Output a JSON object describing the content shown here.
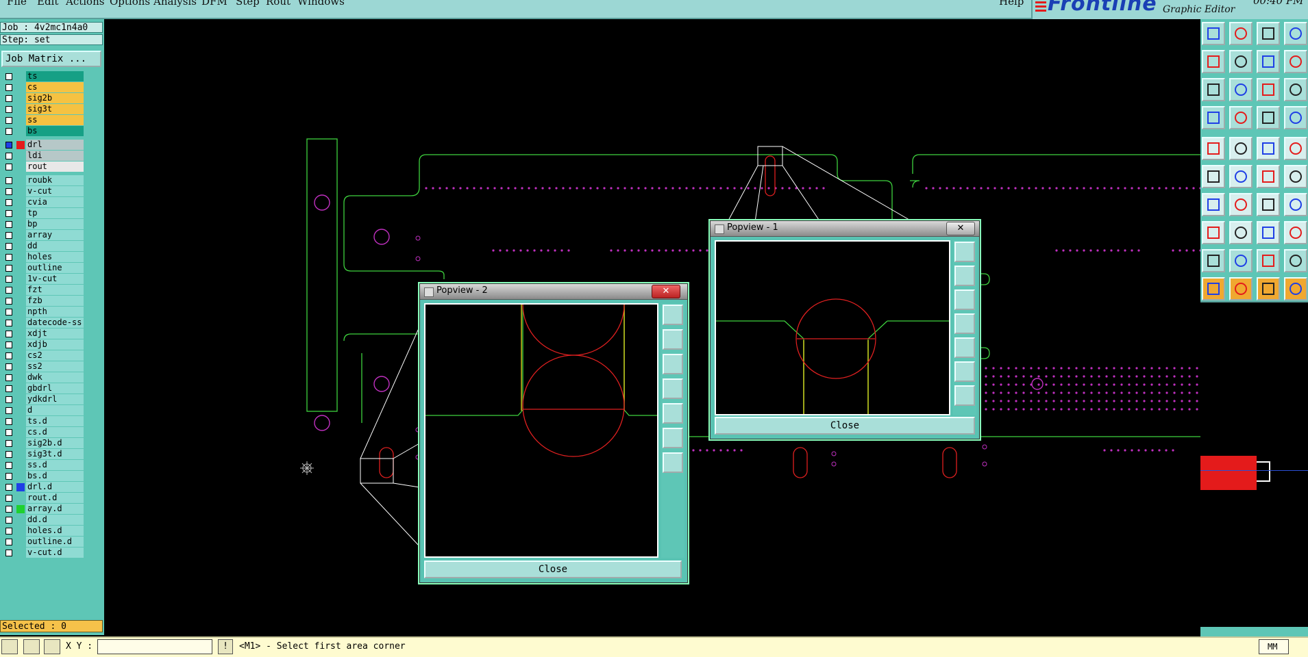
{
  "menu": {
    "items": [
      "File",
      "Edit",
      "Actions",
      "Options",
      "Analysis",
      "DFM",
      "Step",
      "Rout",
      "Windows"
    ],
    "help": "Help"
  },
  "brand": {
    "logo": "Frontline",
    "subtitle": "Graphic Editor",
    "clock": "00:40 PM"
  },
  "job": {
    "job_label": "Job : 4v2mc1n4a0",
    "step_label": "Step: set",
    "matrix_button": "Job Matrix ..."
  },
  "layers": [
    {
      "name": "ts",
      "color": "#16a085"
    },
    {
      "name": "cs",
      "color": "#f5c242"
    },
    {
      "name": "sig2b",
      "color": "#f5c242"
    },
    {
      "name": "sig3t",
      "color": "#f5c242"
    },
    {
      "name": "ss",
      "color": "#f5c242"
    },
    {
      "name": "bs",
      "color": "#16a085"
    },
    {
      "name": "drl",
      "color": "#b6c8c8",
      "swatch": "#e41b1b",
      "checked": true
    },
    {
      "name": "ldi",
      "color": "#b6c8c8"
    },
    {
      "name": "rout",
      "color": "#e8e8e8"
    },
    {
      "name": "roubk",
      "color": "#8fdbd3"
    },
    {
      "name": "v-cut",
      "color": "#8fdbd3"
    },
    {
      "name": "cvia",
      "color": "#8fdbd3"
    },
    {
      "name": "tp",
      "color": "#8fdbd3"
    },
    {
      "name": "bp",
      "color": "#8fdbd3"
    },
    {
      "name": "array",
      "color": "#8fdbd3"
    },
    {
      "name": "dd",
      "color": "#8fdbd3"
    },
    {
      "name": "holes",
      "color": "#8fdbd3"
    },
    {
      "name": "outline",
      "color": "#8fdbd3"
    },
    {
      "name": "1v-cut",
      "color": "#8fdbd3"
    },
    {
      "name": "fzt",
      "color": "#8fdbd3"
    },
    {
      "name": "fzb",
      "color": "#8fdbd3"
    },
    {
      "name": "npth",
      "color": "#8fdbd3"
    },
    {
      "name": "datecode-ss",
      "color": "#8fdbd3"
    },
    {
      "name": "xdjt",
      "color": "#8fdbd3"
    },
    {
      "name": "xdjb",
      "color": "#8fdbd3"
    },
    {
      "name": "cs2",
      "color": "#8fdbd3"
    },
    {
      "name": "ss2",
      "color": "#8fdbd3"
    },
    {
      "name": "dwk",
      "color": "#8fdbd3"
    },
    {
      "name": "gbdrl",
      "color": "#8fdbd3"
    },
    {
      "name": "ydkdrl",
      "color": "#8fdbd3"
    },
    {
      "name": "d",
      "color": "#8fdbd3"
    },
    {
      "name": "ts.d",
      "color": "#8fdbd3"
    },
    {
      "name": "cs.d",
      "color": "#8fdbd3"
    },
    {
      "name": "sig2b.d",
      "color": "#8fdbd3"
    },
    {
      "name": "sig3t.d",
      "color": "#8fdbd3"
    },
    {
      "name": "ss.d",
      "color": "#8fdbd3"
    },
    {
      "name": "bs.d",
      "color": "#8fdbd3"
    },
    {
      "name": "drl.d",
      "color": "#8fdbd3",
      "swatch": "#1f3fe6"
    },
    {
      "name": "rout.d",
      "color": "#8fdbd3"
    },
    {
      "name": "array.d",
      "color": "#8fdbd3",
      "swatch": "#1fd12f"
    },
    {
      "name": "dd.d",
      "color": "#8fdbd3"
    },
    {
      "name": "holes.d",
      "color": "#8fdbd3"
    },
    {
      "name": "outline.d",
      "color": "#8fdbd3"
    },
    {
      "name": "v-cut.d",
      "color": "#8fdbd3"
    }
  ],
  "selected_label": "Selected : 0",
  "popup1": {
    "title": "Popview - 1",
    "close_label": "Close"
  },
  "popup2": {
    "title": "Popview - 2",
    "close_label": "Close"
  },
  "status": {
    "xy_label": "X Y :",
    "xy_value": "",
    "prompt": "<M1> - Select first area corner",
    "units": "MM"
  },
  "colors": {
    "panel": "#5ec6b6",
    "outline": "#3fd33f",
    "drill": "#e02020",
    "pad": "#c030c0"
  }
}
